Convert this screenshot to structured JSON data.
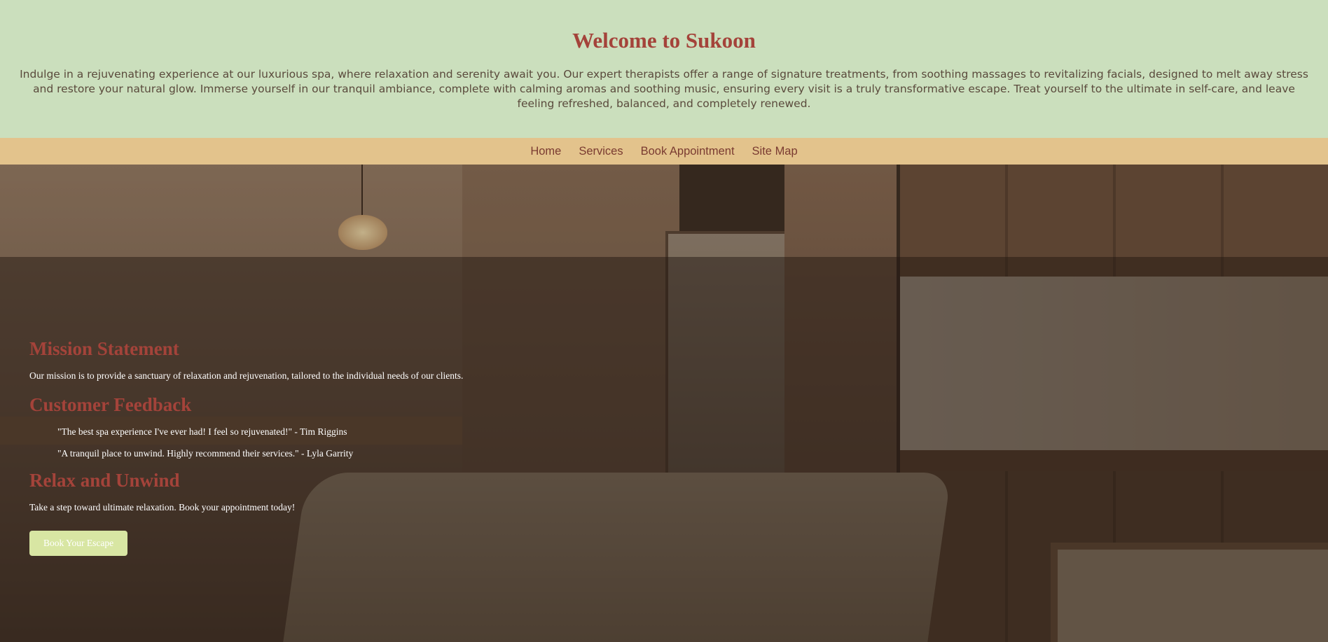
{
  "header": {
    "title": "Welcome to Sukoon",
    "intro": "Indulge in a rejuvenating experience at our luxurious spa, where relaxation and serenity await you. Our expert therapists offer a range of signature treatments, from soothing massages to revitalizing facials, designed to melt away stress and restore your natural glow. Immerse yourself in our tranquil ambiance, complete with calming aromas and soothing music, ensuring every visit is a truly transformative escape. Treat yourself to the ultimate in self-care, and leave feeling refreshed, balanced, and completely renewed."
  },
  "nav": {
    "items": [
      {
        "label": "Home"
      },
      {
        "label": "Services"
      },
      {
        "label": "Book Appointment"
      },
      {
        "label": "Site Map"
      }
    ]
  },
  "mission": {
    "heading": "Mission Statement",
    "text": "Our mission is to provide a sanctuary of relaxation and rejuvenation, tailored to the individual needs of our clients."
  },
  "feedback": {
    "heading": "Customer Feedback",
    "items": [
      "\"The best spa experience I've ever had! I feel so rejuvenated!\" - Tim Riggins",
      "\"A tranquil place to unwind. Highly recommend their services.\" - Lyla Garrity"
    ]
  },
  "relax": {
    "heading": "Relax and Unwind",
    "text": "Take a step toward ultimate relaxation. Book your appointment today!",
    "button_label": "Book Your Escape"
  },
  "colors": {
    "header_bg": "#cbdfbd",
    "nav_bg": "#e3c38c",
    "accent": "#a4433a",
    "cta_bg": "#d8e6a3"
  }
}
